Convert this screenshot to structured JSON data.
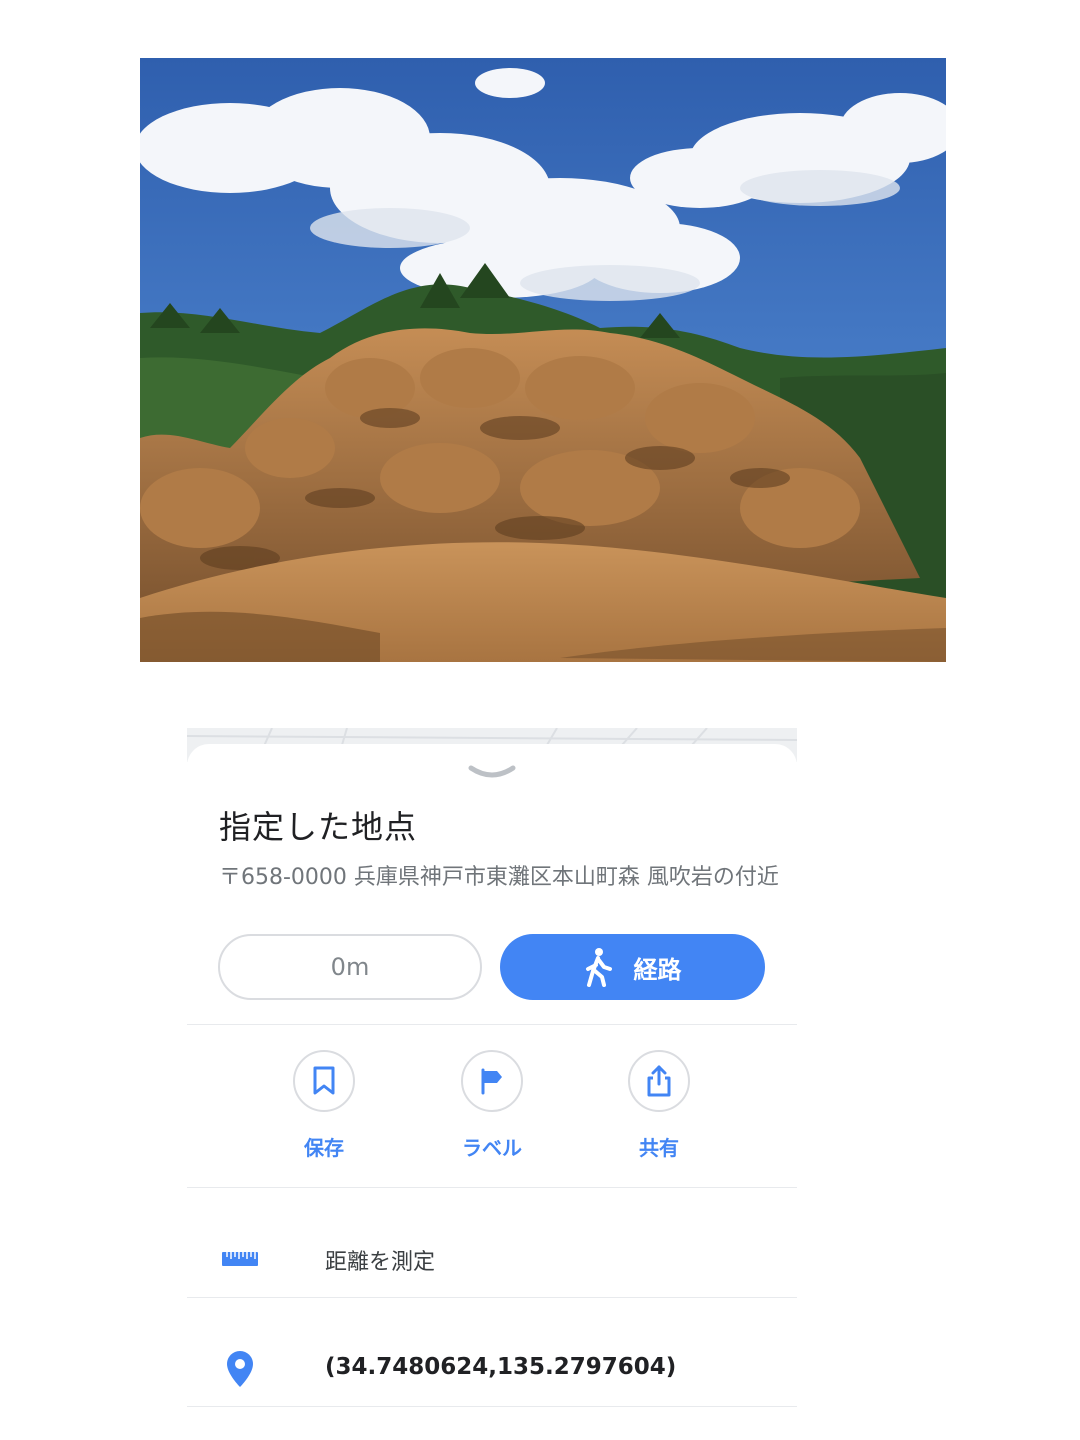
{
  "photo": {
    "description_icon": "photo"
  },
  "place": {
    "title": "指定した地点",
    "address": "〒658-0000 兵庫県神戸市東灘区本山町森 風吹岩の付近"
  },
  "buttons": {
    "distance": "0m",
    "route": "経路"
  },
  "actions": [
    {
      "label": "保存",
      "icon": "bookmark-icon"
    },
    {
      "label": "ラベル",
      "icon": "flag-icon"
    },
    {
      "label": "共有",
      "icon": "share-icon"
    }
  ],
  "rows": {
    "measure": {
      "label": "距離を測定",
      "icon": "ruler-icon"
    },
    "coords": {
      "label": "(34.7480624,135.2797604)",
      "icon": "location-pin-icon"
    }
  },
  "colors": {
    "accent": "#4285f4",
    "divider": "#e8eaed",
    "secondary_text": "#70757a"
  }
}
